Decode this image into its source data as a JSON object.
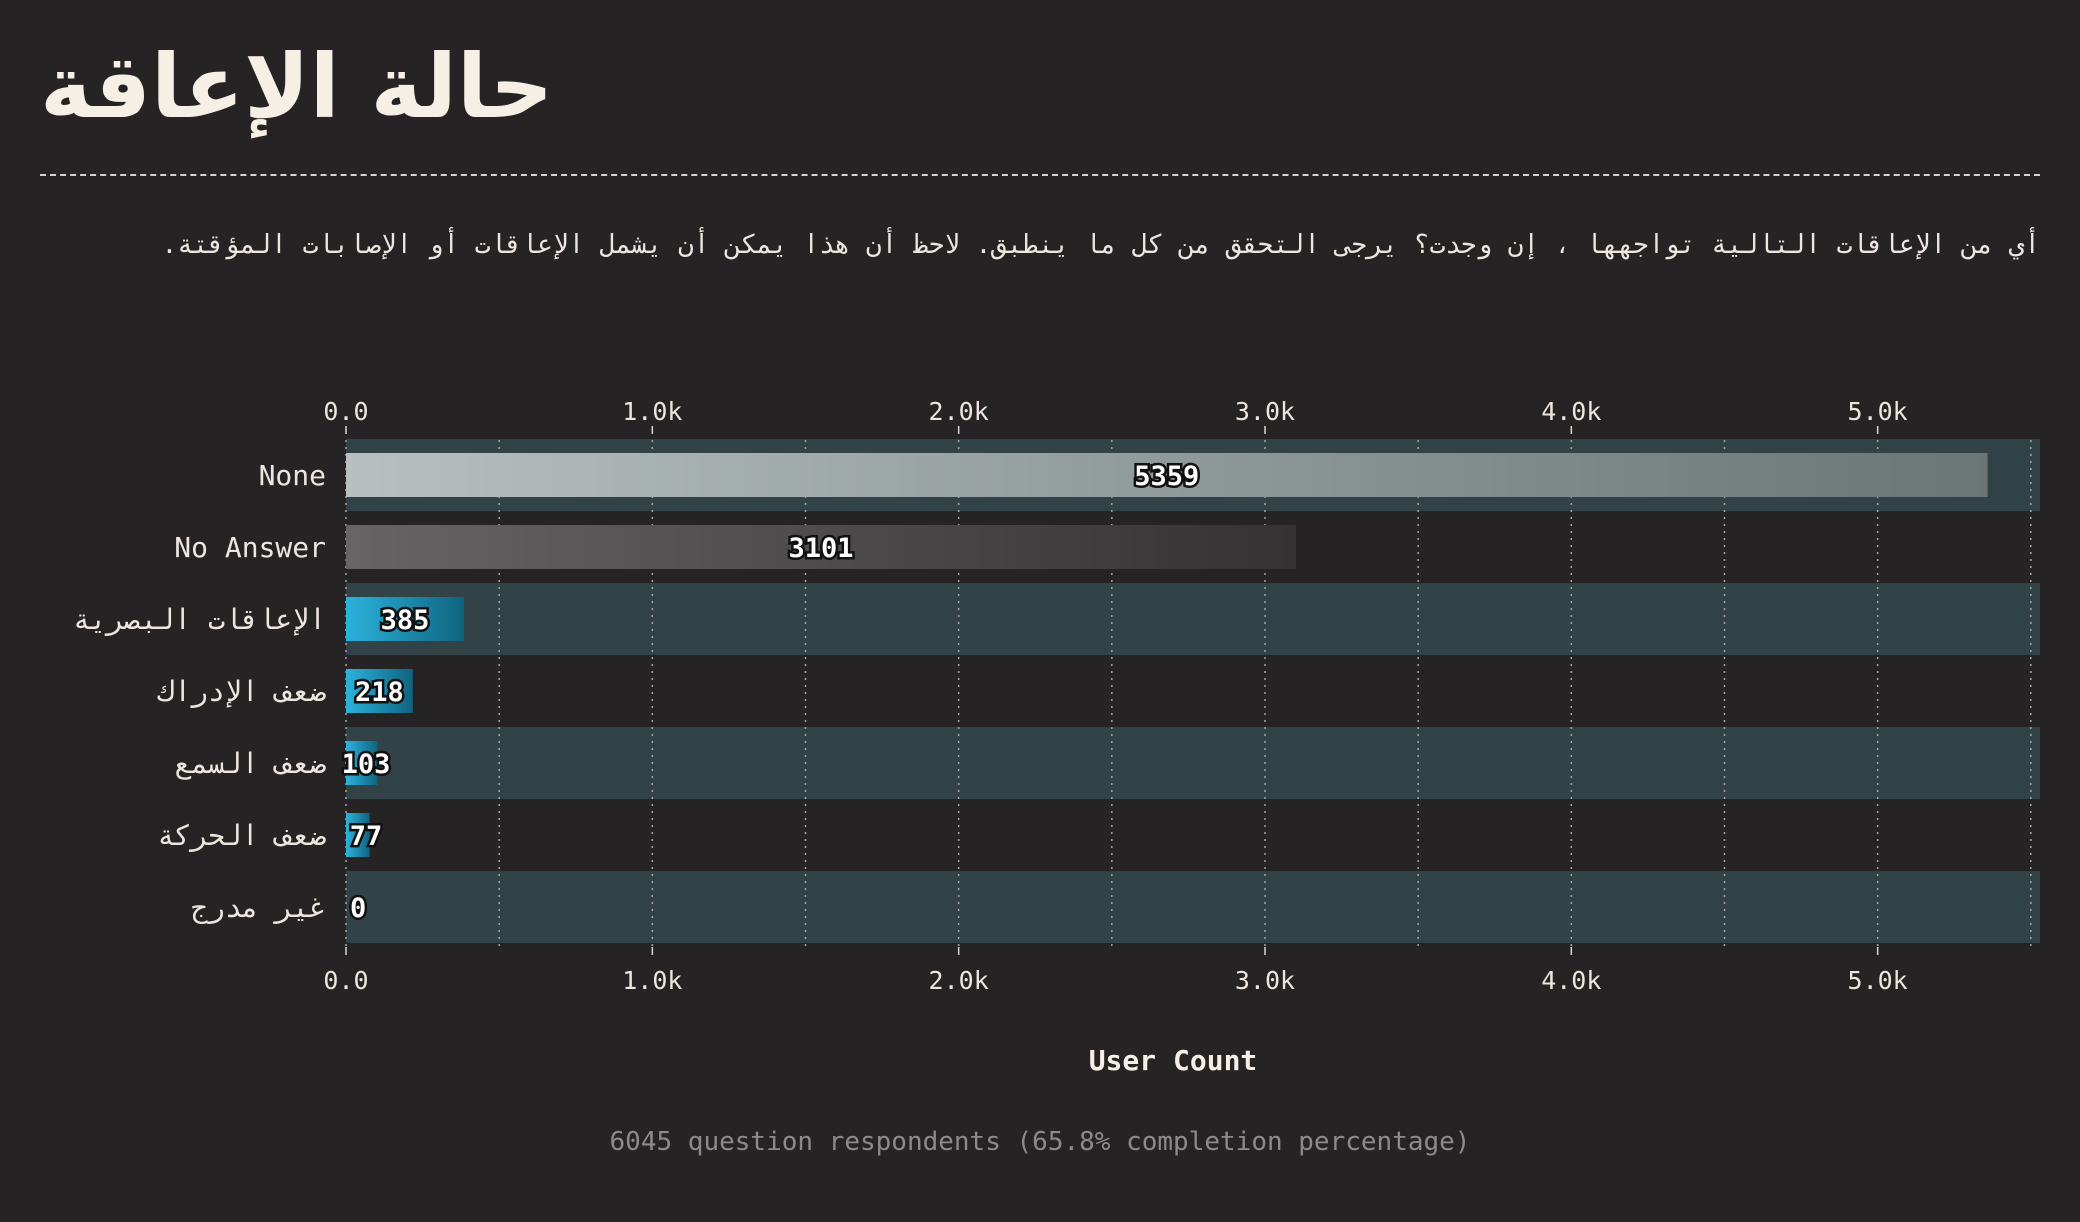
{
  "header": {
    "title": "حالة الإعاقة",
    "question": "أي من الإعاقات التالية تواجهها ، إن وجدت؟ يرجى التحقق من كل ما ينطبق. لاحظ أن هذا يمكن أن يشمل الإعاقات أو الإصابات المؤقتة."
  },
  "footer": {
    "note": "6045 question respondents (65.8% completion percentage)"
  },
  "chart_data": {
    "type": "bar",
    "orientation": "horizontal",
    "categories": [
      "None",
      "No Answer",
      "الإعاقات البصرية",
      "ضعف الإدراك",
      "ضعف السمع",
      "ضعف الحركة",
      "غير مدرج"
    ],
    "values": [
      5359,
      3101,
      385,
      218,
      103,
      77,
      0
    ],
    "xlabel": "User Count",
    "xlim": [
      0,
      5530
    ],
    "xticks": [
      0,
      1000,
      2000,
      3000,
      4000,
      5000
    ],
    "xtick_labels": [
      "0.0",
      "1.0k",
      "2.0k",
      "3.0k",
      "4.0k",
      "5.0k"
    ],
    "tick_positions": [
      "top",
      "bottom"
    ],
    "grid": "vertical-dotted",
    "colors": {
      "background": "#262324",
      "row_band": "#324347",
      "bar_none": [
        "#b7bfbf",
        "#6b7575"
      ],
      "bar_no_answer": [
        "#676465",
        "#363233"
      ],
      "bar_other": [
        "#2bb3dc",
        "#10637f"
      ]
    }
  }
}
